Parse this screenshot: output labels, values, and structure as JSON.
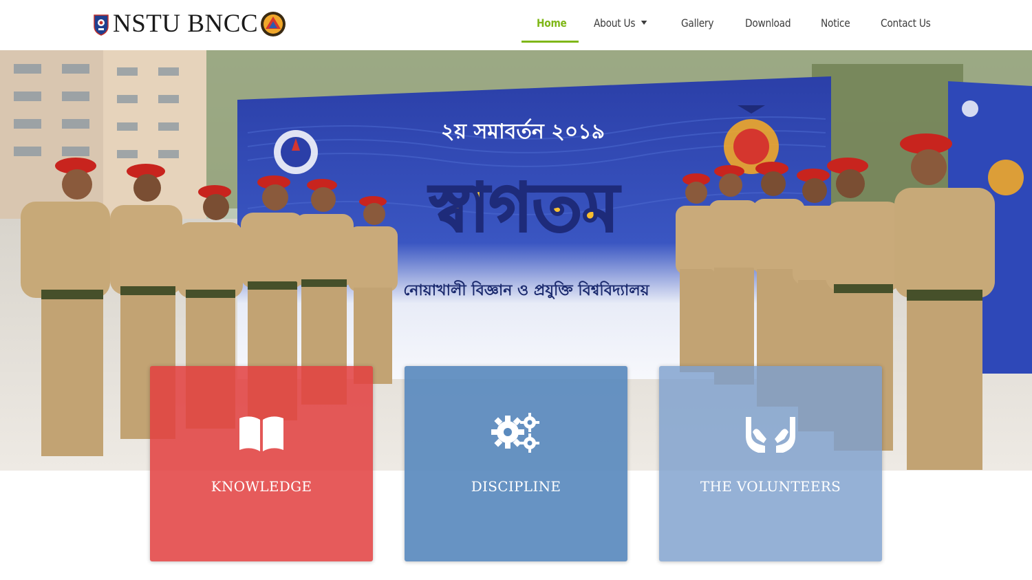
{
  "site": {
    "brand": "NSTU BNCC"
  },
  "nav": {
    "items": [
      {
        "label": "Home",
        "active": true
      },
      {
        "label": "About Us",
        "has_dropdown": true
      },
      {
        "label": "Gallery"
      },
      {
        "label": "Download"
      },
      {
        "label": "Notice"
      },
      {
        "label": "Contact Us"
      }
    ],
    "accent_color": "#7fb718"
  },
  "hero": {
    "banner_line1": "২য় সমাবর্তন ২০১৯",
    "banner_title": "স্বাগতম",
    "banner_line3": "নোয়াখালী বিজ্ঞান ও প্রযুক্তি বিশ্ববিদ্যালয়"
  },
  "features": [
    {
      "title": "KNOWLEDGE",
      "icon": "open-book-icon",
      "color": "#e24040"
    },
    {
      "title": "DISCIPLINE",
      "icon": "gears-icon",
      "color": "#5a8abe"
    },
    {
      "title": "THE VOLUNTEERS",
      "icon": "helping-hands-icon",
      "color": "#7ea0cd"
    }
  ]
}
